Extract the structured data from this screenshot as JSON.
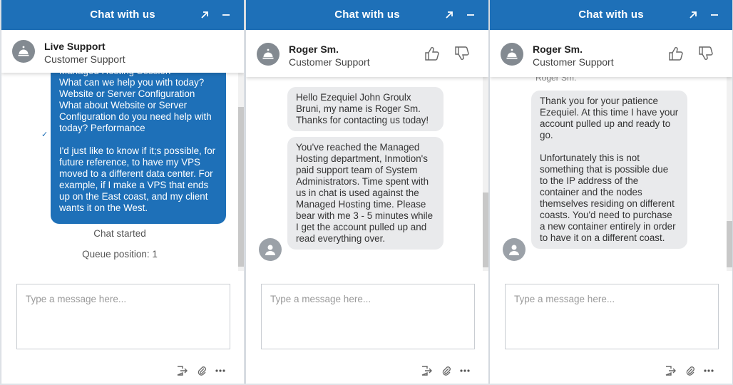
{
  "colors": {
    "primary": "#1e70b8",
    "agent_bubble": "#e9eaec",
    "avatar": "#838a91"
  },
  "icons": {
    "expand": "expand-arrow-icon",
    "minimize": "minimize-icon",
    "support": "service-bell-icon",
    "agent": "user-silhouette-icon",
    "thumbs_up": "thumbs-up-icon",
    "thumbs_down": "thumbs-down-icon",
    "transfer": "exit-chat-icon",
    "attach": "paperclip-icon",
    "more": "ellipsis-icon"
  },
  "panels": [
    {
      "header_title": "Chat with us",
      "agent_name": "Live Support",
      "agent_role": "Customer Support",
      "messages": {
        "user": "Managed Hosting Session\nWhat can we help you with today?\nWebsite or Server Configuration\nWhat about Website or Server Configuration do you need help with today? Performance\n\nI'd just like to know if it;s possible, for future reference, to have my VPS moved to a different data center. For example, if I make a VPS that ends up on the East coast, and my client wants it on the West.",
        "delivered_mark": "✓",
        "system": [
          "Chat started",
          "Queue position: 1"
        ]
      },
      "composer_placeholder": "Type a message here..."
    },
    {
      "header_title": "Chat with us",
      "agent_name": "Roger Sm.",
      "agent_role": "Customer Support",
      "messages": {
        "agent_1": "Hello Ezequiel John Groulx Bruni, my name is Roger Sm. Thanks for contacting us today!",
        "agent_2": "You've reached the Managed Hosting department, Inmotion's paid support team of System Administrators. Time spent with us in chat is used against the Managed Hosting time. Please bear with me 3 - 5 minutes while I get the account pulled up and read everything over."
      },
      "composer_placeholder": "Type a message here..."
    },
    {
      "header_title": "Chat with us",
      "agent_name": "Roger Sm.",
      "agent_role": "Customer Support",
      "messages": {
        "sender_label": "Roger Sm.",
        "agent_1": "Thank you for your patience Ezequiel. At this time I have your account pulled up and ready to go.\n\nUnfortunately this is not something that is possible due to the IP address of the container and the nodes themselves residing on different coasts. You'd need to purchase a new container entirely in order to have it on a different coast."
      },
      "composer_placeholder": "Type a message here..."
    }
  ]
}
